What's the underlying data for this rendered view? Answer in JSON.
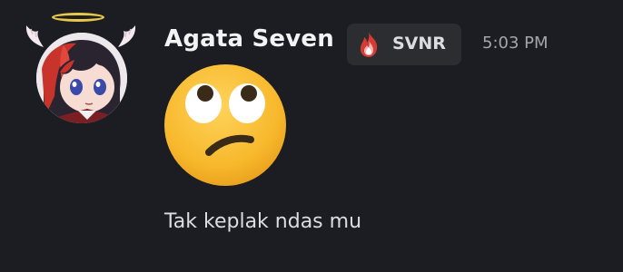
{
  "message": {
    "author": {
      "name": "Agata Seven",
      "avatar_icon": "anime-angel-avatar-icon"
    },
    "tag": {
      "icon": "fire-icon",
      "label": "SVNR"
    },
    "timestamp": "5:03 PM",
    "emoji": {
      "icon": "face-with-rolling-eyes-emoji"
    },
    "text": "Tak keplak ndas mu"
  },
  "colors": {
    "background": "#1c1d22",
    "username": "#f2f3f5",
    "tag_background": "#2b2d31",
    "timestamp": "#a3a6ac",
    "message_text": "#dbdee1"
  }
}
